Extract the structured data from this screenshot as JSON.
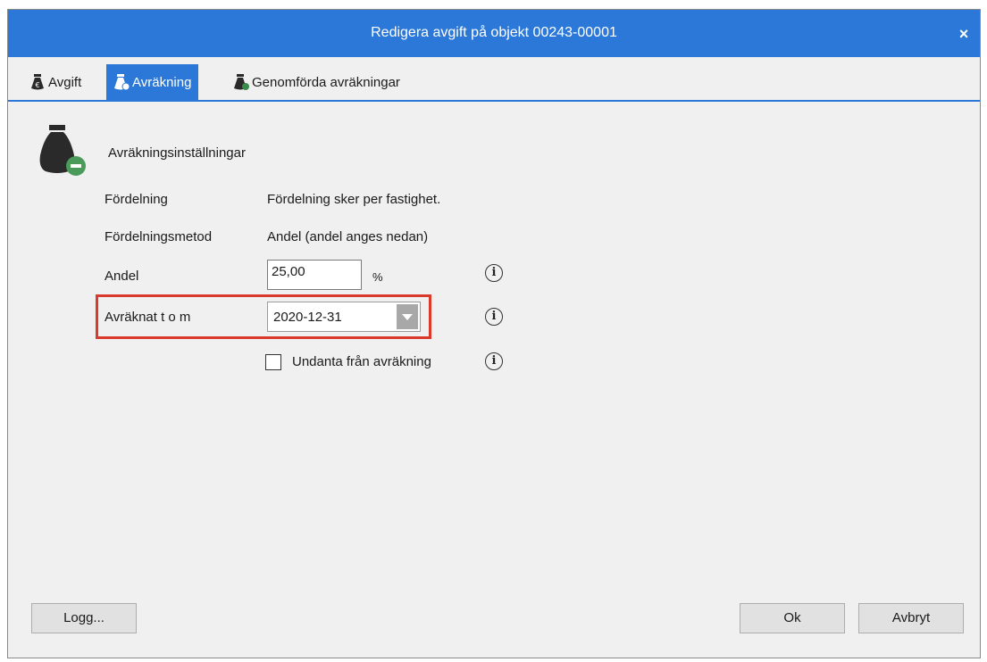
{
  "window": {
    "title": "Redigera avgift på objekt 00243-00001",
    "close_label": "×"
  },
  "tabs": [
    {
      "label": "Avgift",
      "icon": "moneybag-euro-icon",
      "active": false
    },
    {
      "label": "Avräkning",
      "icon": "moneybag-minus-icon",
      "active": true
    },
    {
      "label": "Genomförda avräkningar",
      "icon": "moneybag-done-icon",
      "active": false
    }
  ],
  "section": {
    "title": "Avräkningsinställningar",
    "icon": "moneybag-minus-icon"
  },
  "fields": {
    "fordelning": {
      "label": "Fördelning",
      "value": "Fördelning sker per fastighet."
    },
    "metod": {
      "label": "Fördelningsmetod",
      "value": "Andel (andel anges nedan)"
    },
    "andel": {
      "label": "Andel",
      "value": "25,00",
      "unit": "%"
    },
    "avraknat": {
      "label": "Avräknat t o m",
      "value": "2020-12-31"
    },
    "undanta": {
      "label": "Undanta från avräkning",
      "checked": false
    }
  },
  "info_glyph": "i",
  "buttons": {
    "logg": "Logg...",
    "ok": "Ok",
    "avbryt": "Avbryt"
  },
  "colors": {
    "accent": "#2b78d8",
    "highlight": "#d93a2b"
  }
}
